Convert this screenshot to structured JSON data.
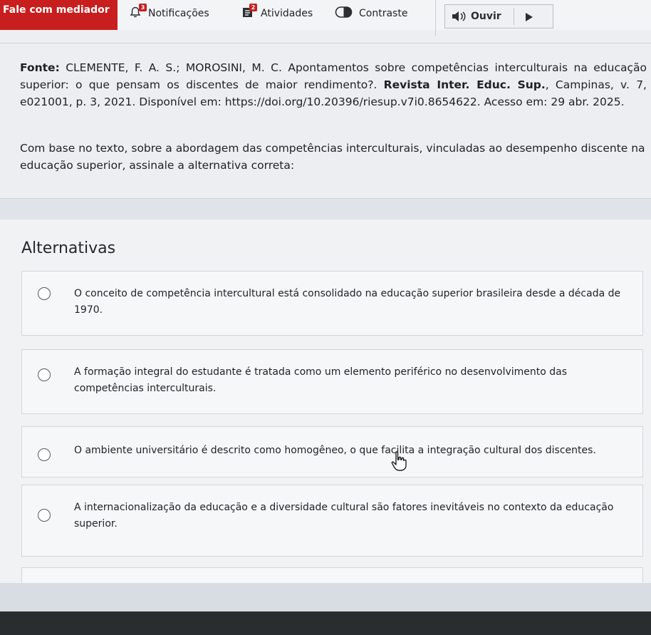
{
  "toolbar": {
    "mediator_label": "Fale com mediador",
    "notifications_label": "Notificações",
    "notifications_badge": "3",
    "activities_label": "Atividades",
    "activities_badge": "2",
    "contrast_label": "Contraste",
    "listen_label": "Ouvir"
  },
  "question": {
    "source_prefix": "Fonte:",
    "source_main": " CLEMENTE, F. A. S.; MOROSINI, M. C. Apontamentos sobre competências interculturais na educação superior: o que pensam os discentes de maior rendimento?. ",
    "source_journal": "Revista Inter. Educ. Sup.",
    "source_rest": ", Campinas, v. 7, e021001, p. 3, 2021. Disponível em: https://doi.org/10.20396/riesup.v7i0.8654622. Acesso em: 29 abr. 2025.",
    "prompt": "Com base no texto, sobre a abordagem das competências interculturais, vinculadas ao desempenho discente na educação superior, assinale a alternativa correta:"
  },
  "alternatives": {
    "title": "Alternativas",
    "options": [
      {
        "text": "O conceito de competência intercultural está consolidado na educação superior brasileira desde a década de 1970."
      },
      {
        "text": "A formação integral do estudante é tratada como um elemento periférico no desenvolvimento das competências interculturais."
      },
      {
        "text": "O ambiente universitário é descrito como homogêneo, o que facilita a integração cultural dos discentes."
      },
      {
        "text": "A internacionalização da educação e a diversidade cultural são fatores inevitáveis no contexto da educação superior."
      }
    ]
  },
  "colors": {
    "mediator_bg": "#c81e1e",
    "page_bg": "#eceef2"
  }
}
